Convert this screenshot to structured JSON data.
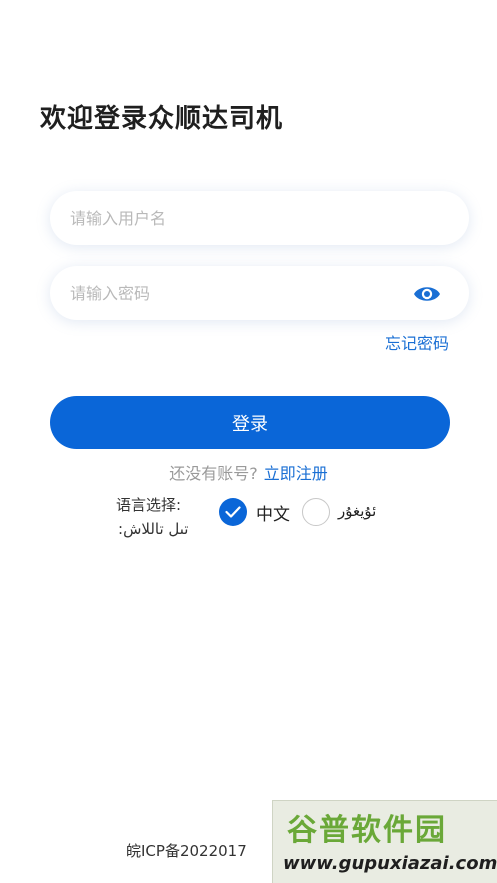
{
  "header": {
    "title": "欢迎登录众顺达司机"
  },
  "login_form": {
    "username_placeholder": "请输入用户名",
    "password_placeholder": "请输入密码",
    "forgot_password": "忘记密码",
    "login_button": "登录"
  },
  "register": {
    "prompt": "还没有账号?",
    "link": "立即注册"
  },
  "language": {
    "label_zh": "语言选择:",
    "label_ug": ":تىل تاللاش",
    "options": [
      {
        "label": "中文",
        "selected": true
      },
      {
        "label": "ئۇيغۇر",
        "selected": false
      }
    ]
  },
  "footer": {
    "icp": "皖ICP备2022017"
  },
  "watermark": {
    "main": "谷普软件园",
    "sub": "www.gupuxiazai.com"
  },
  "colors": {
    "accent": "#0a66d8",
    "link": "#1a6fd4"
  },
  "icons": {
    "password_toggle": "eye-icon",
    "selected_option": "check-icon"
  }
}
